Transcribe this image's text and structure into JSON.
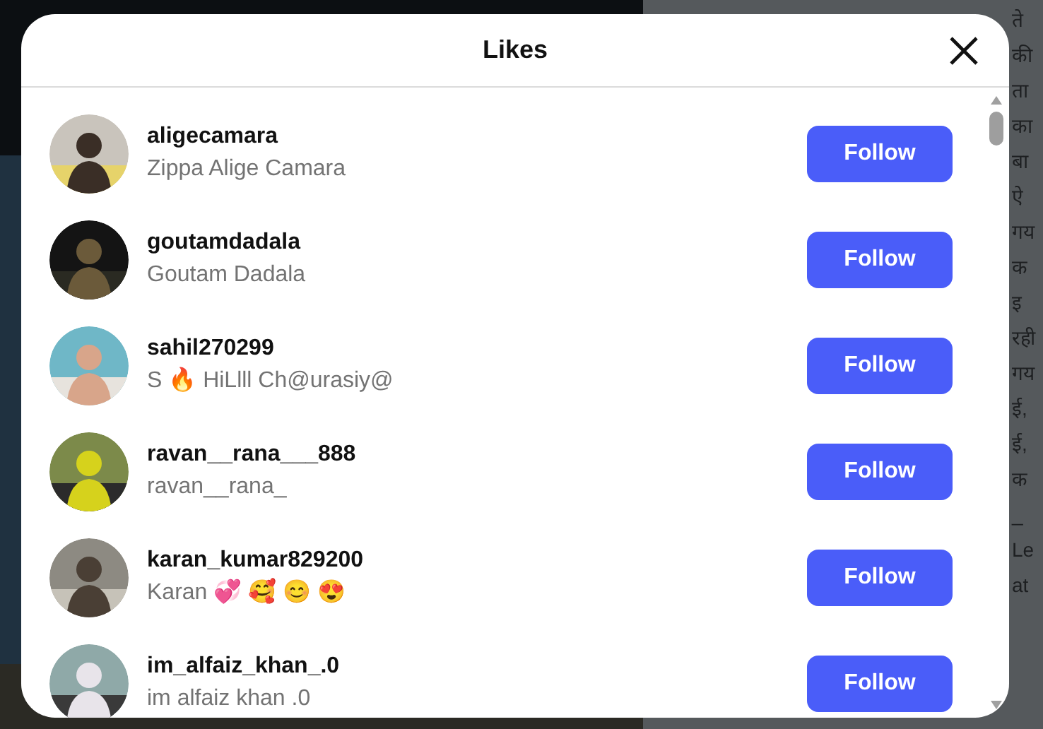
{
  "background_text": [
    "ते",
    "की",
    "ता",
    "का",
    "बा",
    "ऐ",
    "गय",
    "क",
    "इ",
    "रही",
    "गय",
    "ई,",
    "ई,",
    "क",
    "_",
    "Le",
    "at"
  ],
  "dialog": {
    "title": "Likes",
    "users": [
      {
        "username": "aligecamara",
        "name": "Zippa Alige Camara",
        "button": "Follow"
      },
      {
        "username": "goutamdadala",
        "name": "Goutam Dadala",
        "button": "Follow"
      },
      {
        "username": "sahil270299",
        "name": "S 🔥 HiLlll Ch@urasiy@",
        "button": "Follow"
      },
      {
        "username": "ravan__rana___888",
        "name": "ravan__rana_",
        "button": "Follow"
      },
      {
        "username": "karan_kumar829200",
        "name": "Karan 💞 🥰 😊 😍",
        "button": "Follow"
      },
      {
        "username": "im_alfaiz_khan_.0",
        "name": "im alfaiz khan .0",
        "button": "Follow"
      }
    ]
  }
}
